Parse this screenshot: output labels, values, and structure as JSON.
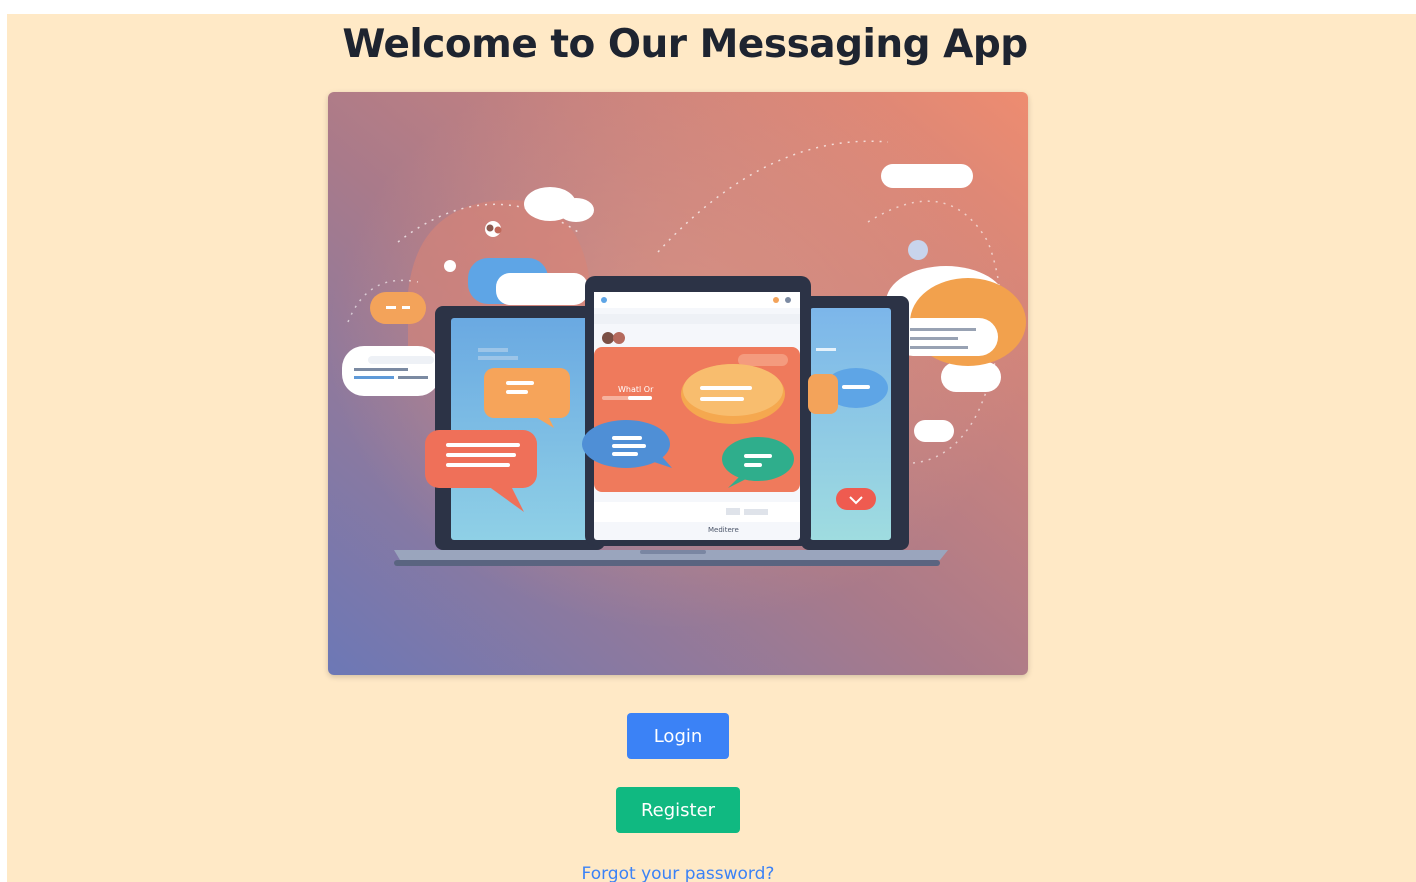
{
  "header": {
    "title": "Welcome to Our Messaging App"
  },
  "hero": {
    "image_name": "messaging-app-illustration",
    "screen_label_left": "Whatl Or",
    "screen_label_bottom": "Meditere"
  },
  "actions": {
    "login_label": "Login",
    "register_label": "Register",
    "forgot_label": "Forgot your password?"
  },
  "colors": {
    "page_background": "#ffe9c6",
    "title": "#1e2430",
    "login_button": "#3b82f6",
    "register_button": "#10b981",
    "link": "#3b82f6"
  }
}
